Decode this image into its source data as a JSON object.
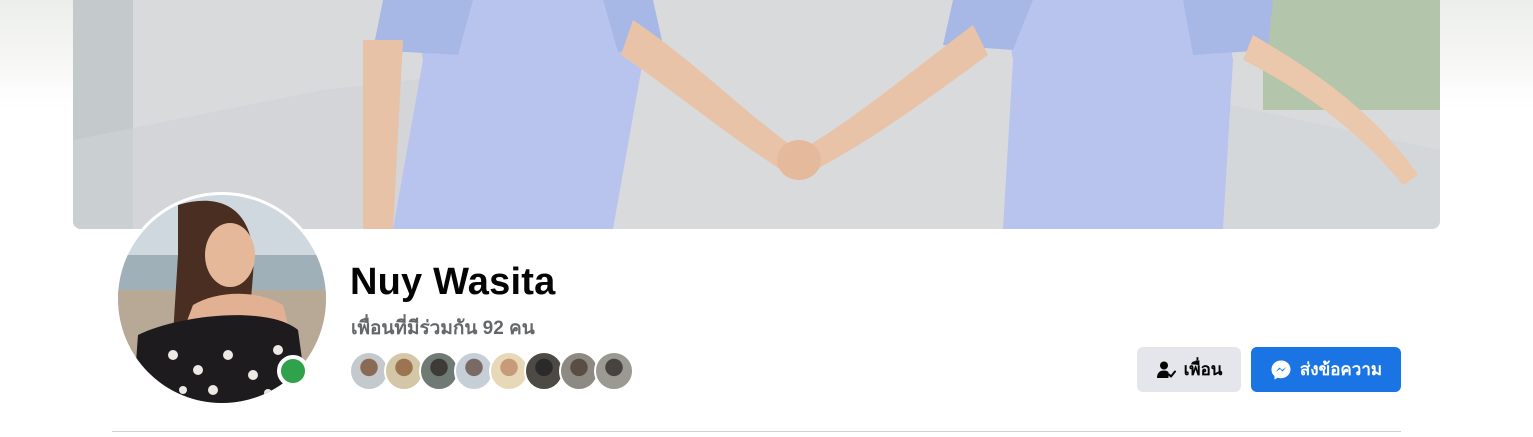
{
  "profile": {
    "name": "Nuy Wasita",
    "mutual_friends_text": "เพื่อนที่มีร่วมกัน 92 คน",
    "online": true,
    "mutual_friend_avatar_count": 8
  },
  "actions": {
    "friends_label": "เพื่อน",
    "message_label": "ส่งข้อความ"
  },
  "colors": {
    "primary": "#1b74e4",
    "secondary_button": "#e4e6eb",
    "online_status": "#31a24c",
    "text_primary": "#050505",
    "text_secondary": "#65676b"
  },
  "icons": {
    "friends_button": "person-check-icon",
    "message_button": "messenger-icon"
  }
}
